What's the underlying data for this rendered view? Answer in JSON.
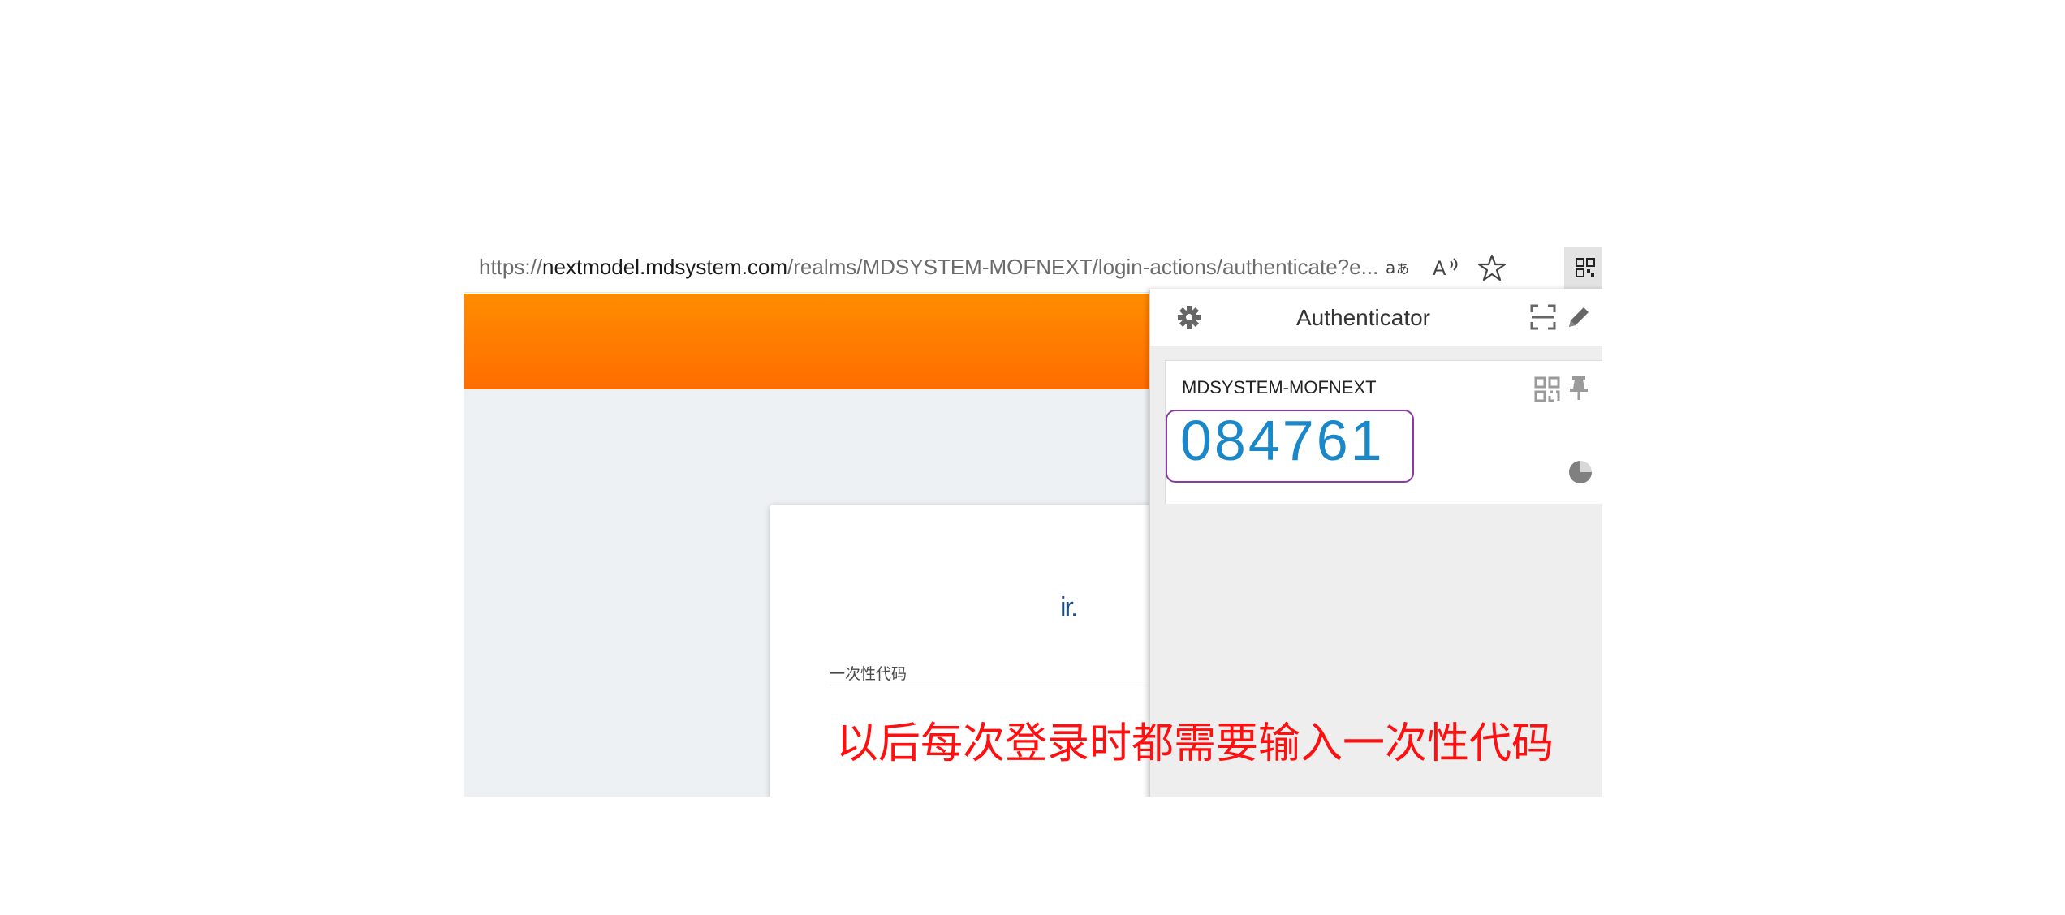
{
  "browser": {
    "url_prefix": "https://",
    "url_host": "nextmodel.mdsystem.com",
    "url_path": "/realms/MDSYSTEM-MOFNEXT/login-actions/authenticate?e...",
    "translate_icon": "translate-icon",
    "read_aloud_icon": "read-aloud-icon",
    "favorite_icon": "star-icon",
    "extension_icon": "qr-code-icon"
  },
  "page": {
    "header_color": "#ff7a00",
    "logo_fragment": "ir.",
    "otp_label": "一次性代码"
  },
  "authenticator": {
    "title": "Authenticator",
    "settings_icon": "gear-icon",
    "scan_icon": "scan-icon",
    "edit_icon": "pencil-icon",
    "account": {
      "issuer": "MDSYSTEM-MOFNEXT",
      "code": "084761",
      "qr_icon": "qr-code-icon",
      "pin_icon": "pin-icon",
      "timer_icon": "timer-pie-icon",
      "code_color": "#1a87c9"
    }
  },
  "annotation": {
    "caption": "以后每次登录时都需要输入一次性代码",
    "caption_color": "#ff1010",
    "highlight_color": "#8a3aa6"
  }
}
